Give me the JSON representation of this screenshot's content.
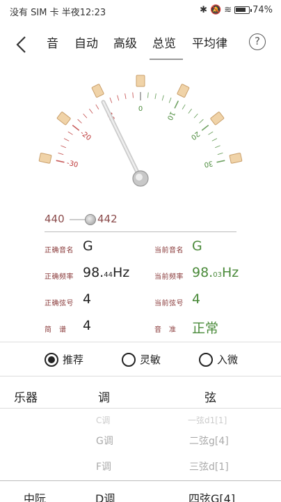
{
  "status_bar": {
    "left_text": "没有 SIM 卡 半夜12:23",
    "battery": "74%"
  },
  "nav": {
    "back": "<",
    "tabs": [
      "音",
      "自动",
      "高级",
      "总览",
      "平均律"
    ],
    "active_tab": "总览",
    "help": "?"
  },
  "gauge": {
    "tick_labels": [
      "-30",
      "-20",
      "-10",
      "0",
      "10",
      "20",
      "30"
    ],
    "needle_cents": -10
  },
  "reference": {
    "value_left": "440",
    "value_right": "442"
  },
  "info": {
    "correct_note_label": "正确音名",
    "correct_note": "G",
    "current_note_label": "当前音名",
    "current_note": "G",
    "correct_freq_label": "正确频率",
    "correct_freq_int": "98.",
    "correct_freq_dec": "44",
    "correct_freq_unit": "Hz",
    "current_freq_label": "当前频率",
    "current_freq_int": "98.",
    "current_freq_dec": "03",
    "current_freq_unit": "Hz",
    "correct_string_label": "正确弦号",
    "correct_string": "4",
    "current_string_label": "当前弦号",
    "current_string": "4",
    "jianpu_label": "简　谱",
    "jianpu": "4",
    "pitch_label": "音　准",
    "pitch": "正常"
  },
  "modes": {
    "options": [
      "推荐",
      "灵敏",
      "入微"
    ],
    "selected": "推荐"
  },
  "table": {
    "headers": [
      "乐器",
      "调",
      "弦"
    ],
    "rows": [
      {
        "key": "C调",
        "string": "一弦d1[1]"
      },
      {
        "key": "G调",
        "string": "二弦g[4]"
      },
      {
        "key": "F调",
        "string": "三弦d[1]"
      }
    ],
    "selected": {
      "instrument": "中阮",
      "key": "D调",
      "string": "四弦G[4]"
    }
  }
}
